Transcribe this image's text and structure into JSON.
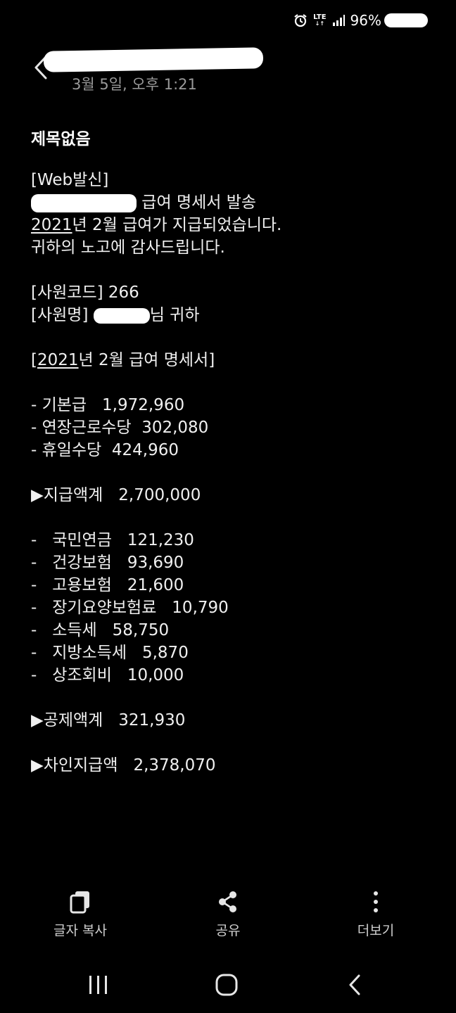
{
  "status_bar": {
    "network": "LTE",
    "battery": "96%"
  },
  "header": {
    "date": "3월 5일, 오후 1:21"
  },
  "message": {
    "title": "제목없음",
    "web_tag": "[Web발신]",
    "notice_suffix": " 급여 명세서 발송",
    "paid_year": "2021",
    "paid_rest": "년 2월 급여가 지급되었습니다.",
    "thanks": "귀하의 노고에 감사드립니다.",
    "employee_code": "[사원코드] 266",
    "employee_name_prefix": "[사원명] ",
    "employee_name_suffix": "님 귀하",
    "statement_open": "[",
    "statement_year": "2021",
    "statement_rest": "년 2월 급여 명세서]",
    "earnings": [
      {
        "label": "- 기본급",
        "amount": "1,972,960"
      },
      {
        "label": "- 연장근로수당",
        "amount": "302,080"
      },
      {
        "label": "- 휴일수당",
        "amount": "424,960"
      }
    ],
    "total_pay": {
      "label": "▶지급액계",
      "amount": "2,700,000"
    },
    "deductions": [
      {
        "label": "-   국민연금",
        "amount": "121,230"
      },
      {
        "label": "-   건강보험",
        "amount": "93,690"
      },
      {
        "label": "-   고용보험",
        "amount": "21,600"
      },
      {
        "label": "-   장기요양보험료",
        "amount": "10,790"
      },
      {
        "label": "-   소득세",
        "amount": "58,750"
      },
      {
        "label": "-   지방소득세",
        "amount": "5,870"
      },
      {
        "label": "-   상조회비",
        "amount": "10,000"
      }
    ],
    "total_deduction": {
      "label": "▶공제액계",
      "amount": "321,930"
    },
    "net_pay": {
      "label": "▶차인지급액",
      "amount": "2,378,070"
    }
  },
  "actions": {
    "copy_text": "글자 복사",
    "share": "공유",
    "more": "더보기"
  },
  "icons": {
    "back": "chevron-left-icon",
    "copy": "copy-icon",
    "share": "share-icon",
    "more": "more-vertical-icon",
    "nav_recents": "recents-icon",
    "nav_home": "home-icon",
    "nav_back": "nav-back-icon"
  }
}
